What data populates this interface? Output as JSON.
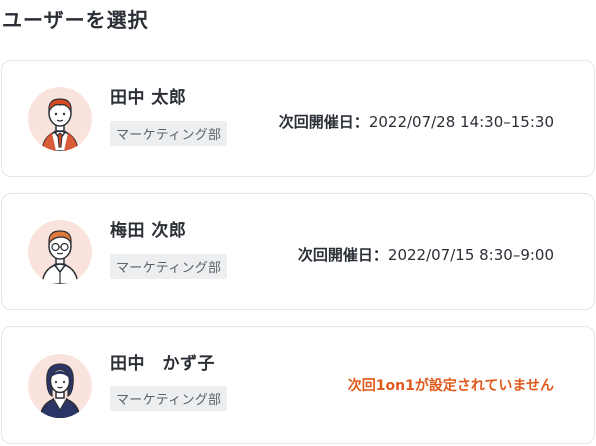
{
  "page": {
    "title": "ユーザーを選択"
  },
  "colors": {
    "avatar_bg": "#fbe3dd",
    "dept_bg": "#eceef0",
    "warning": "#e05a1c",
    "border": "#e3e5e8"
  },
  "users": [
    {
      "name": "田中 太郎",
      "department": "マーケティング部",
      "avatar_icon": "male-avatar-icon",
      "schedule_label": "次回開催日：",
      "schedule_value": "2022/07/28 14:30–15:30"
    },
    {
      "name": "梅田 次郎",
      "department": "マーケティング部",
      "avatar_icon": "male-glasses-avatar-icon",
      "schedule_label": "次回開催日：",
      "schedule_value": "2022/07/15 8:30–9:00"
    },
    {
      "name": "田中　かず子",
      "department": "マーケティング部",
      "avatar_icon": "female-avatar-icon",
      "no_schedule_text": "次回1on1が設定されていません"
    }
  ]
}
